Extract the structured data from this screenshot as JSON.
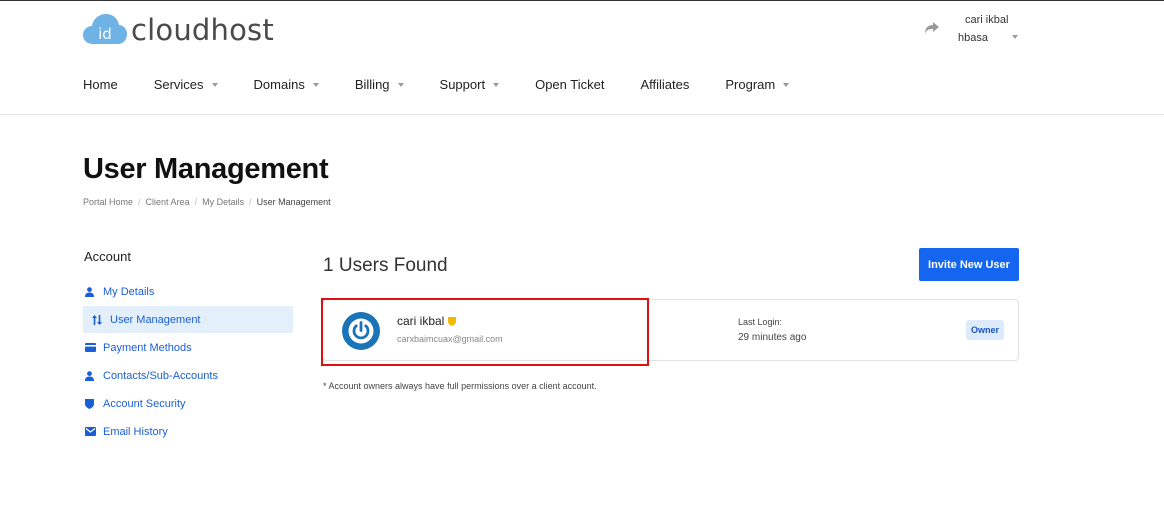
{
  "brand": {
    "logo_mark": "id",
    "name": "cloudhost",
    "logo_color": "#6eb2e6"
  },
  "user_menu": {
    "name_line1": "cari ikbal",
    "name_line2": "hbasa",
    "icon": "share-arrow-icon"
  },
  "nav": {
    "items": [
      {
        "label": "Home",
        "dropdown": false
      },
      {
        "label": "Services",
        "dropdown": true
      },
      {
        "label": "Domains",
        "dropdown": true
      },
      {
        "label": "Billing",
        "dropdown": true
      },
      {
        "label": "Support",
        "dropdown": true
      },
      {
        "label": "Open Ticket",
        "dropdown": false
      },
      {
        "label": "Affiliates",
        "dropdown": false
      },
      {
        "label": "Program",
        "dropdown": true
      }
    ]
  },
  "page": {
    "title": "User Management",
    "breadcrumb": [
      "Portal Home",
      "Client Area",
      "My Details",
      "User Management"
    ]
  },
  "sidebar": {
    "title": "Account",
    "items": [
      {
        "label": "My Details",
        "icon": "user-icon",
        "active": false
      },
      {
        "label": "User Management",
        "icon": "sort-arrows-icon",
        "active": true
      },
      {
        "label": "Payment Methods",
        "icon": "credit-card-icon",
        "active": false
      },
      {
        "label": "Contacts/Sub-Accounts",
        "icon": "user-icon",
        "active": false
      },
      {
        "label": "Account Security",
        "icon": "shield-icon",
        "active": false
      },
      {
        "label": "Email History",
        "icon": "envelope-icon",
        "active": false
      }
    ]
  },
  "users": {
    "heading": "1 Users Found",
    "invite_label": "Invite New User",
    "list": [
      {
        "name": "cari ikbal",
        "email": "carxbaimcuax@gmail.com",
        "last_login_label": "Last Login:",
        "last_login_value": "29 minutes ago",
        "role_badge": "Owner"
      }
    ],
    "footnote": "* Account owners always have full permissions over a client account."
  },
  "colors": {
    "accent": "#1465f0",
    "link": "#1a5fd6",
    "active_bg": "#e4effc",
    "highlight": "#e01010",
    "shield_badge": "#f5b800"
  }
}
